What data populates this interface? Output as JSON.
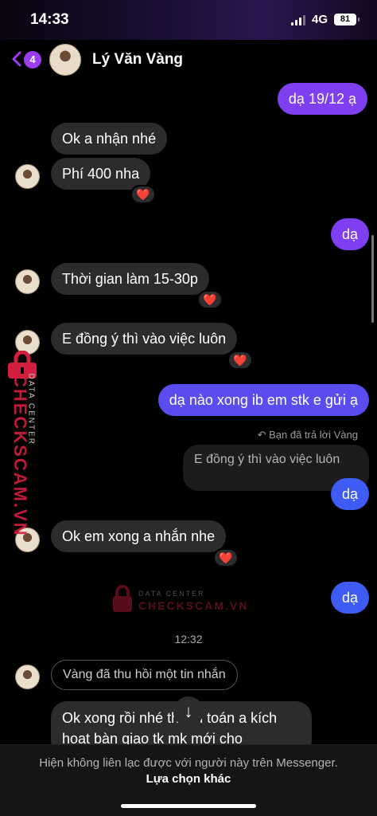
{
  "status": {
    "time": "14:33",
    "network": "4G",
    "battery": "81"
  },
  "header": {
    "back_count": "4",
    "contact_name": "Lý Văn Vàng"
  },
  "messages": {
    "m1": "dạ 19/12 ạ",
    "m2": "Ok a nhận nhé",
    "m3": "Phí 400 nha",
    "m4": "dạ",
    "m5": "Thời gian làm 15-30p",
    "m6": "E đồng ý thì vào việc luôn",
    "m7": "dạ nào xong ib em stk e gửi ạ",
    "reply_note": "Bạn đã trả lời Vàng",
    "quoted": "E đồng ý thì vào việc luôn",
    "m8": "dạ",
    "m9": "Ok em xong a nhắn nhe",
    "m10": "dạ",
    "timestamp": "12:32",
    "recalled": "Vàng đã thu hồi một tin nhắn",
    "m11": "Ok xong rồi nhé thanh toán a kích hoat bàn giao tk mk mới cho"
  },
  "reactions": {
    "emoji": "❤️"
  },
  "watermark": {
    "brand": "CHECKSCAM.VN",
    "tagline": "DATA CENTER"
  },
  "footer": {
    "notice": "Hiện không liên lạc được với người này trên Messenger.",
    "action": "Lựa chọn khác"
  },
  "icons": {
    "scroll_down": "↓",
    "back": "chevron-left-icon",
    "reply": "reply-icon"
  }
}
